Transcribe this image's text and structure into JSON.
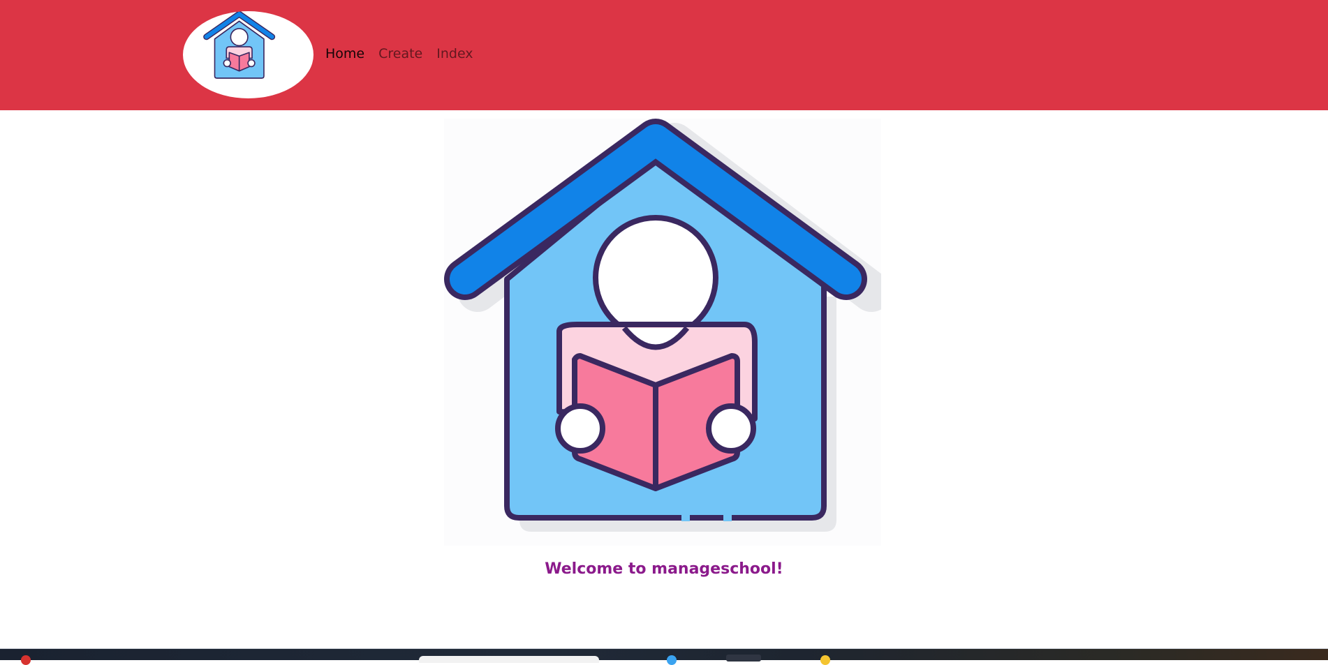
{
  "navbar": {
    "background": "#dc3545",
    "brand_icon": "school-house-reading-logo",
    "links": [
      {
        "label": "Home",
        "active": true
      },
      {
        "label": "Create",
        "active": false
      },
      {
        "label": "Index",
        "active": false
      }
    ]
  },
  "main": {
    "hero_icon": "school-house-reading-illustration",
    "welcome_text": "Welcome to manageschool!",
    "welcome_color": "#8b1a8b"
  },
  "colors": {
    "roof_blue": "#1183e8",
    "house_light_blue": "#72c5f7",
    "outline": "#3a2860",
    "shirt_pink": "#fcd3e0",
    "book_pink": "#f77a9c"
  }
}
